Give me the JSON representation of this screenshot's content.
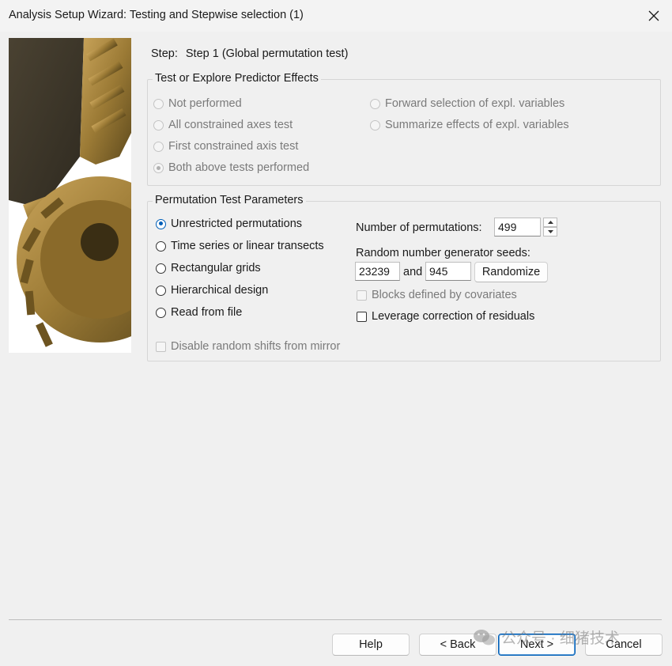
{
  "window": {
    "title": "Analysis Setup Wizard: Testing and Stepwise selection (1)",
    "close_icon": "close-icon"
  },
  "step": {
    "label": "Step:",
    "value": "Step 1 (Global permutation test)"
  },
  "predictor_effects": {
    "legend": "Test or Explore Predictor Effects",
    "options": [
      {
        "label": "Not performed",
        "checked": false,
        "enabled": false
      },
      {
        "label": "All constrained axes test",
        "checked": false,
        "enabled": false
      },
      {
        "label": "First constrained axis test",
        "checked": false,
        "enabled": false
      },
      {
        "label": "Both above tests performed",
        "checked": true,
        "enabled": false
      },
      {
        "label": "Forward selection of expl. variables",
        "checked": false,
        "enabled": false
      },
      {
        "label": "Summarize effects of expl. variables",
        "checked": false,
        "enabled": false
      }
    ]
  },
  "permutation": {
    "legend": "Permutation Test Parameters",
    "types": [
      {
        "label": "Unrestricted permutations",
        "checked": true
      },
      {
        "label": "Time series or linear transects",
        "checked": false
      },
      {
        "label": "Rectangular grids",
        "checked": false
      },
      {
        "label": "Hierarchical design",
        "checked": false
      },
      {
        "label": "Read from file",
        "checked": false
      }
    ],
    "disable_shifts": {
      "label": "Disable random shifts from mirror",
      "checked": false,
      "enabled": false
    },
    "num_permutations_label": "Number of permutations:",
    "num_permutations": "499",
    "seeds_label": "Random number generator seeds:",
    "seed1": "23239",
    "and_label": "and",
    "seed2": "945",
    "randomize_label": "Randomize",
    "blocks": {
      "label": "Blocks defined by covariates",
      "checked": false,
      "enabled": false
    },
    "leverage": {
      "label": "Leverage correction of residuals",
      "checked": false,
      "enabled": true
    }
  },
  "footer": {
    "help": "Help",
    "back": "< Back",
    "next": "Next >",
    "cancel": "Cancel"
  },
  "watermark": {
    "text": "公众号 · 细猪技术",
    "icon": "wechat-icon"
  },
  "colors": {
    "accent": "#005fb8",
    "background": "#f0f0f0",
    "disabled_text": "#7a7a7a"
  }
}
